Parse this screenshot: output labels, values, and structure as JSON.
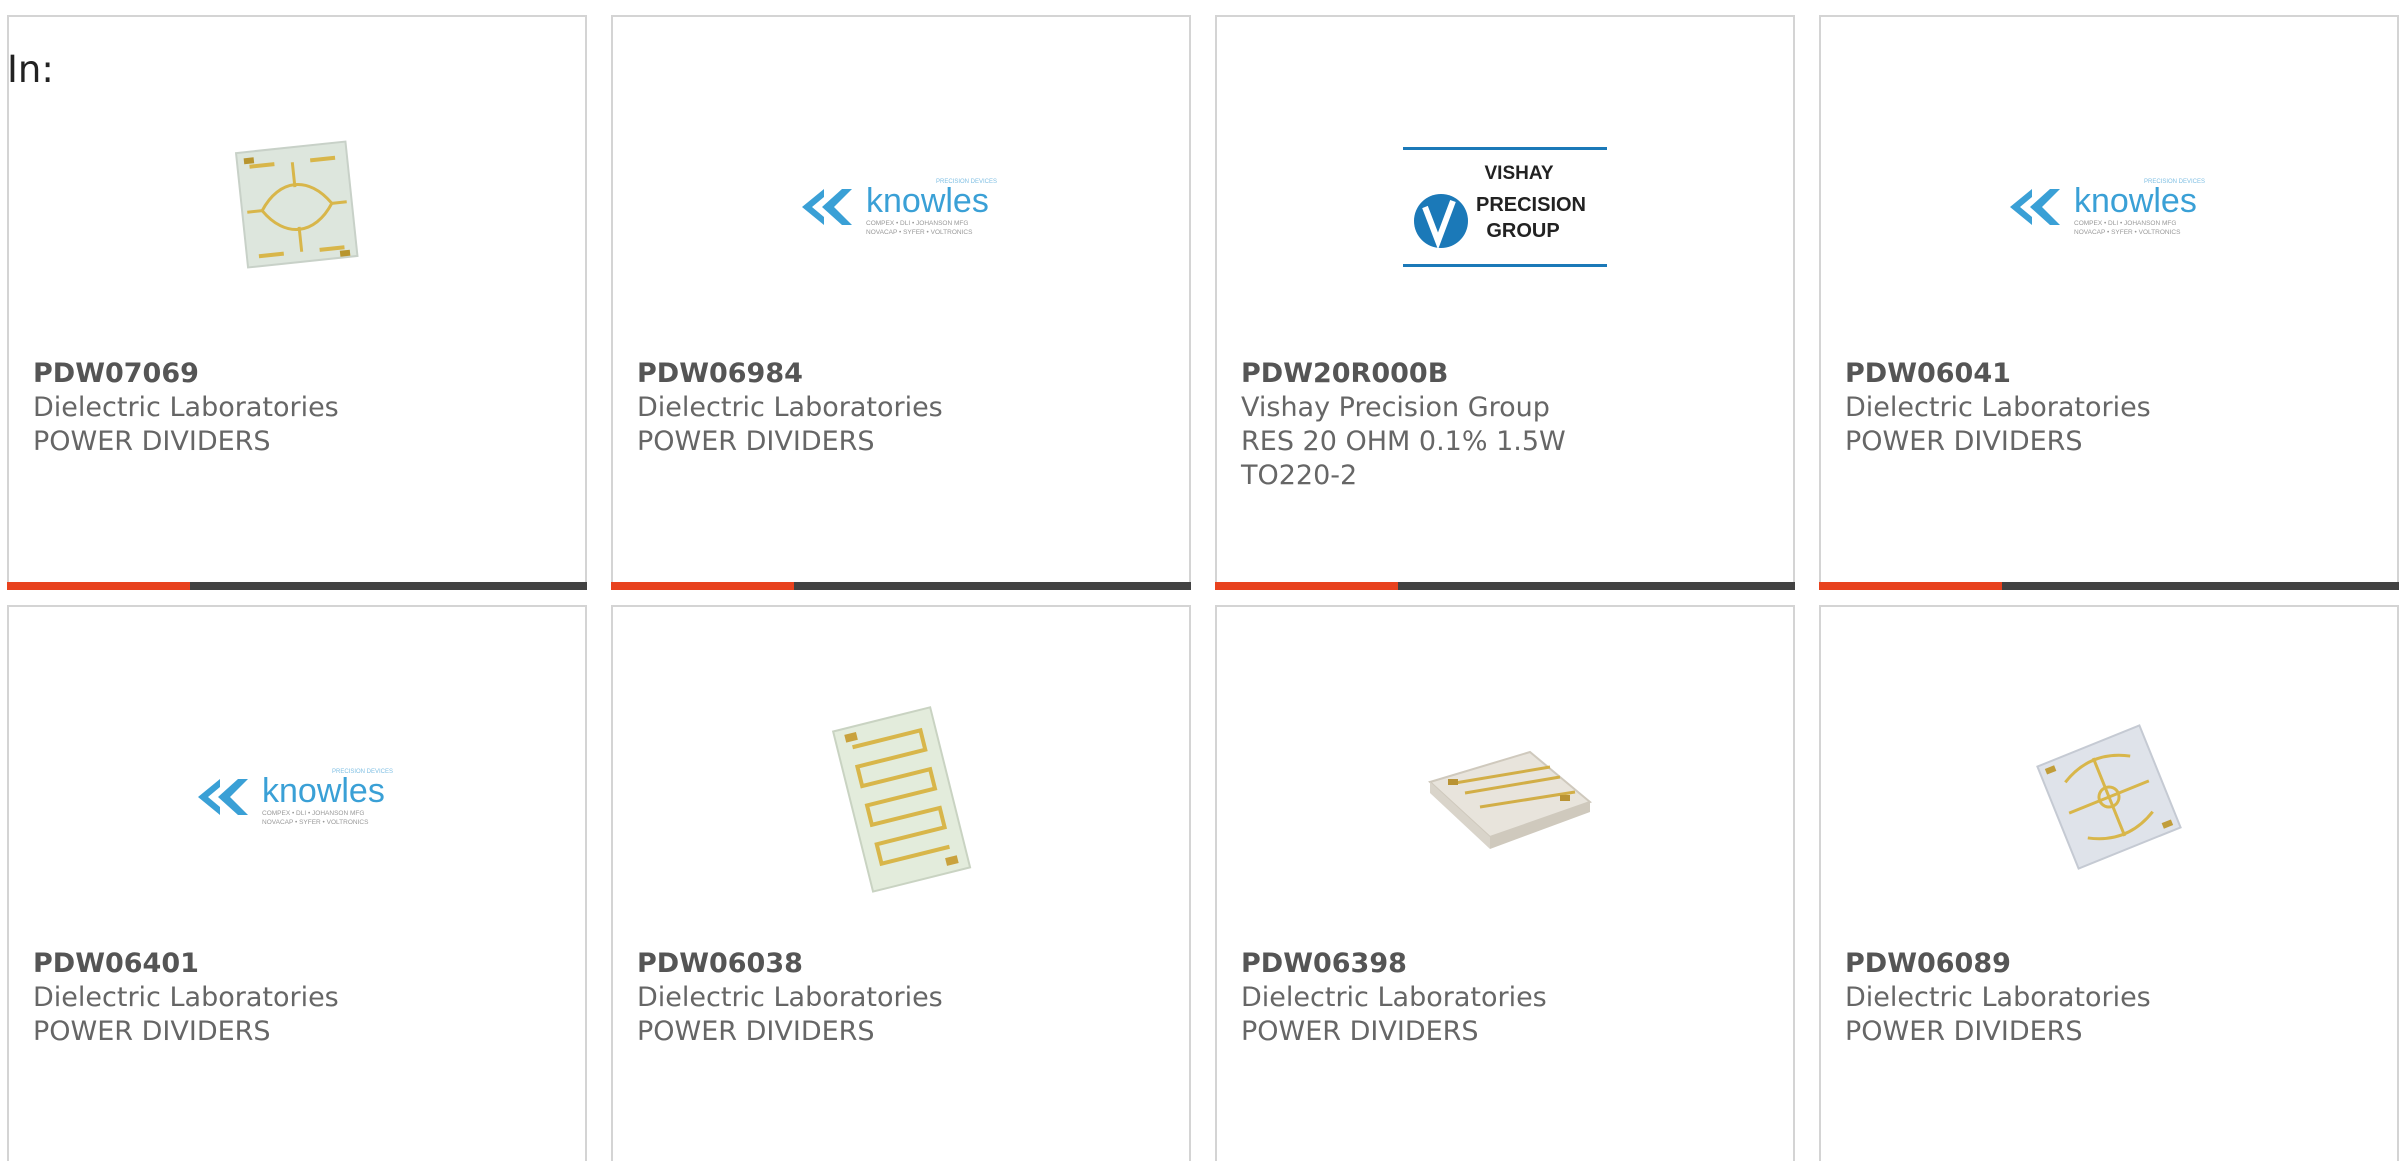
{
  "filter": {
    "label": "In:"
  },
  "products": [
    {
      "part": "PDW07069",
      "manufacturer": "Dielectric Laboratories",
      "description": "POWER DIVIDERS",
      "image": "square-chip-splitter"
    },
    {
      "part": "PDW06984",
      "manufacturer": "Dielectric Laboratories",
      "description": "POWER DIVIDERS",
      "image": "knowles-logo"
    },
    {
      "part": "PDW20R000B",
      "manufacturer": "Vishay Precision Group",
      "description": "RES 20 OHM 0.1% 1.5W TO220-2",
      "image": "vishay-precision-group-logo"
    },
    {
      "part": "PDW06041",
      "manufacturer": "Dielectric Laboratories",
      "description": "POWER DIVIDERS",
      "image": "knowles-logo"
    },
    {
      "part": "PDW06401",
      "manufacturer": "Dielectric Laboratories",
      "description": "POWER DIVIDERS",
      "image": "knowles-logo"
    },
    {
      "part": "PDW06038",
      "manufacturer": "Dielectric Laboratories",
      "description": "POWER DIVIDERS",
      "image": "meander-chip"
    },
    {
      "part": "PDW06398",
      "manufacturer": "Dielectric Laboratories",
      "description": "POWER DIVIDERS",
      "image": "block-chip"
    },
    {
      "part": "PDW06089",
      "manufacturer": "Dielectric Laboratories",
      "description": "POWER DIVIDERS",
      "image": "square-chip-splitter"
    }
  ],
  "logos": {
    "knowles": {
      "name": "knowles",
      "tagline_top": "PRECISION DEVICES",
      "tagline_1": "COMPEX • DLI • JOHANSON MFG",
      "tagline_2": "NOVACAP • SYFER • VOLTRONICS"
    },
    "vishay": {
      "line1": "VISHAY",
      "line2": "PRECISION",
      "line3": "GROUP"
    }
  },
  "colors": {
    "accent": "#e8421e",
    "bar": "#424242",
    "border": "#d4d4d4",
    "knowles_blue": "#3aa0d6",
    "vishay_blue": "#1b79b8"
  }
}
